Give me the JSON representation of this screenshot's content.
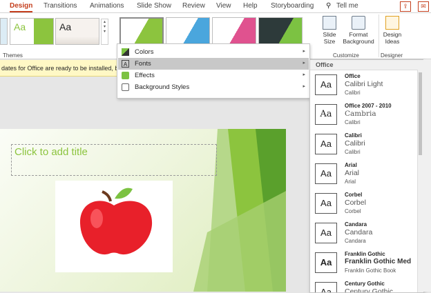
{
  "tabs": [
    {
      "label": "Design",
      "active": true
    },
    {
      "label": "Transitions"
    },
    {
      "label": "Animations"
    },
    {
      "label": "Slide Show"
    },
    {
      "label": "Review"
    },
    {
      "label": "View"
    },
    {
      "label": "Help"
    },
    {
      "label": "Storyboarding"
    }
  ],
  "tell_me": "Tell me",
  "ribbon": {
    "themes_label": "Themes",
    "theme_aa": "Aa",
    "slide_size": "Slide Size",
    "format_background": "Format Background",
    "design_ideas": "Design Ideas",
    "customize_label": "Customize",
    "designer_label": "Designer"
  },
  "notice_text": "dates for Office are ready to be installed, but",
  "menu": [
    {
      "label": "Colors",
      "icon": "colors-icon",
      "arrow": "▸"
    },
    {
      "label": "Fonts",
      "icon": "fonts-icon",
      "arrow": "▸"
    },
    {
      "label": "Effects",
      "icon": "effects-icon",
      "arrow": "▸"
    },
    {
      "label": "Background Styles",
      "icon": "background-styles-icon",
      "arrow": "▸"
    }
  ],
  "fonts_panel": {
    "header": "Office",
    "items": [
      {
        "name": "Office",
        "heading": "Calibri Light",
        "body": "Calibri",
        "aa": "Aa"
      },
      {
        "name": "Office 2007 - 2010",
        "heading": "Cambria",
        "body": "Calibri",
        "aa": "Aa"
      },
      {
        "name": "Calibri",
        "heading": "Calibri",
        "body": "Calibri",
        "aa": "Aa"
      },
      {
        "name": "Arial",
        "heading": "Arial",
        "body": "Arial",
        "aa": "Aa"
      },
      {
        "name": "Corbel",
        "heading": "Corbel",
        "body": "Corbel",
        "aa": "Aa"
      },
      {
        "name": "Candara",
        "heading": "Candara",
        "body": "Candara",
        "aa": "Aa"
      },
      {
        "name": "Franklin Gothic",
        "heading": "Franklin Gothic Med",
        "body": "Franklin Gothic Book",
        "aa": "Aa"
      },
      {
        "name": "Century Gothic",
        "heading": "Century Gothic",
        "body": "",
        "aa": "Aa"
      }
    ]
  },
  "slide": {
    "title_placeholder": "Click to add title"
  },
  "colors": {
    "accent": "#c43e1c",
    "slide_title": "#8cc43e",
    "apple_red": "#e8202a",
    "leaf_green": "#7cc242",
    "highlight": "#c8c8c8",
    "notice_bg": "#fff8c5"
  }
}
